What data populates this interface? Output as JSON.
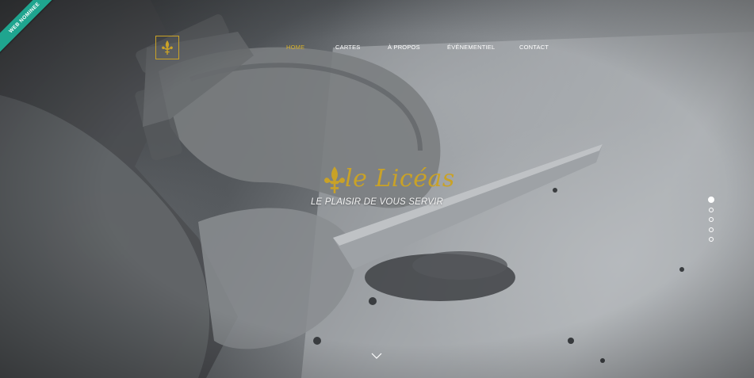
{
  "ribbon": {
    "text": "WEB NOMINEE"
  },
  "brand": {
    "name": "le Licéas",
    "tagline": "LE PLAISIR DE VOUS SERVIR",
    "accent_color": "#c9a227",
    "logo_icon": "fleur-de-lis-icon"
  },
  "nav": {
    "active_color": "#d6b02a",
    "items": [
      {
        "label": "HOME",
        "active": true
      },
      {
        "label": "CARTES",
        "active": false
      },
      {
        "label": "À PROPOS",
        "active": false
      },
      {
        "label": "ÉVÉNEMENTIEL",
        "active": false
      },
      {
        "label": "CONTACT",
        "active": false
      }
    ]
  },
  "slider": {
    "slide_count": 5,
    "active_slide": 1
  },
  "scroll": {
    "icon": "chevron-down-icon"
  }
}
